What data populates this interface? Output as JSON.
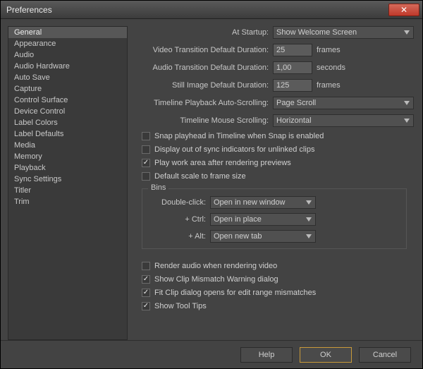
{
  "window": {
    "title": "Preferences"
  },
  "sidebar": {
    "items": [
      "General",
      "Appearance",
      "Audio",
      "Audio Hardware",
      "Auto Save",
      "Capture",
      "Control Surface",
      "Device Control",
      "Label Colors",
      "Label Defaults",
      "Media",
      "Memory",
      "Playback",
      "Sync Settings",
      "Titler",
      "Trim"
    ],
    "selected": 0
  },
  "general": {
    "atStartup": {
      "label": "At Startup:",
      "value": "Show Welcome Screen"
    },
    "videoTransition": {
      "label": "Video Transition Default Duration:",
      "value": "25",
      "unit": "frames"
    },
    "audioTransition": {
      "label": "Audio Transition Default Duration:",
      "value": "1,00",
      "unit": "seconds"
    },
    "stillImage": {
      "label": "Still Image Default Duration:",
      "value": "125",
      "unit": "frames"
    },
    "playbackScroll": {
      "label": "Timeline Playback Auto-Scrolling:",
      "value": "Page Scroll"
    },
    "mouseScroll": {
      "label": "Timeline Mouse Scrolling:",
      "value": "Horizontal"
    },
    "checks": {
      "snapPlayhead": {
        "label": "Snap playhead in Timeline when Snap is enabled",
        "checked": false
      },
      "outOfSync": {
        "label": "Display out of sync indicators for unlinked clips",
        "checked": false
      },
      "playWorkArea": {
        "label": "Play work area after rendering previews",
        "checked": true
      },
      "defaultScale": {
        "label": "Default scale to frame size",
        "checked": false
      },
      "renderAudio": {
        "label": "Render audio when rendering video",
        "checked": false
      },
      "clipMismatch": {
        "label": "Show Clip Mismatch Warning dialog",
        "checked": true
      },
      "fitClip": {
        "label": "Fit Clip dialog opens for edit range mismatches",
        "checked": true
      },
      "toolTips": {
        "label": "Show Tool Tips",
        "checked": true
      }
    },
    "bins": {
      "legend": "Bins",
      "doubleClick": {
        "label": "Double-click:",
        "value": "Open in new window"
      },
      "ctrl": {
        "label": "+ Ctrl:",
        "value": "Open in place"
      },
      "alt": {
        "label": "+ Alt:",
        "value": "Open new tab"
      }
    }
  },
  "footer": {
    "help": "Help",
    "ok": "OK",
    "cancel": "Cancel"
  }
}
